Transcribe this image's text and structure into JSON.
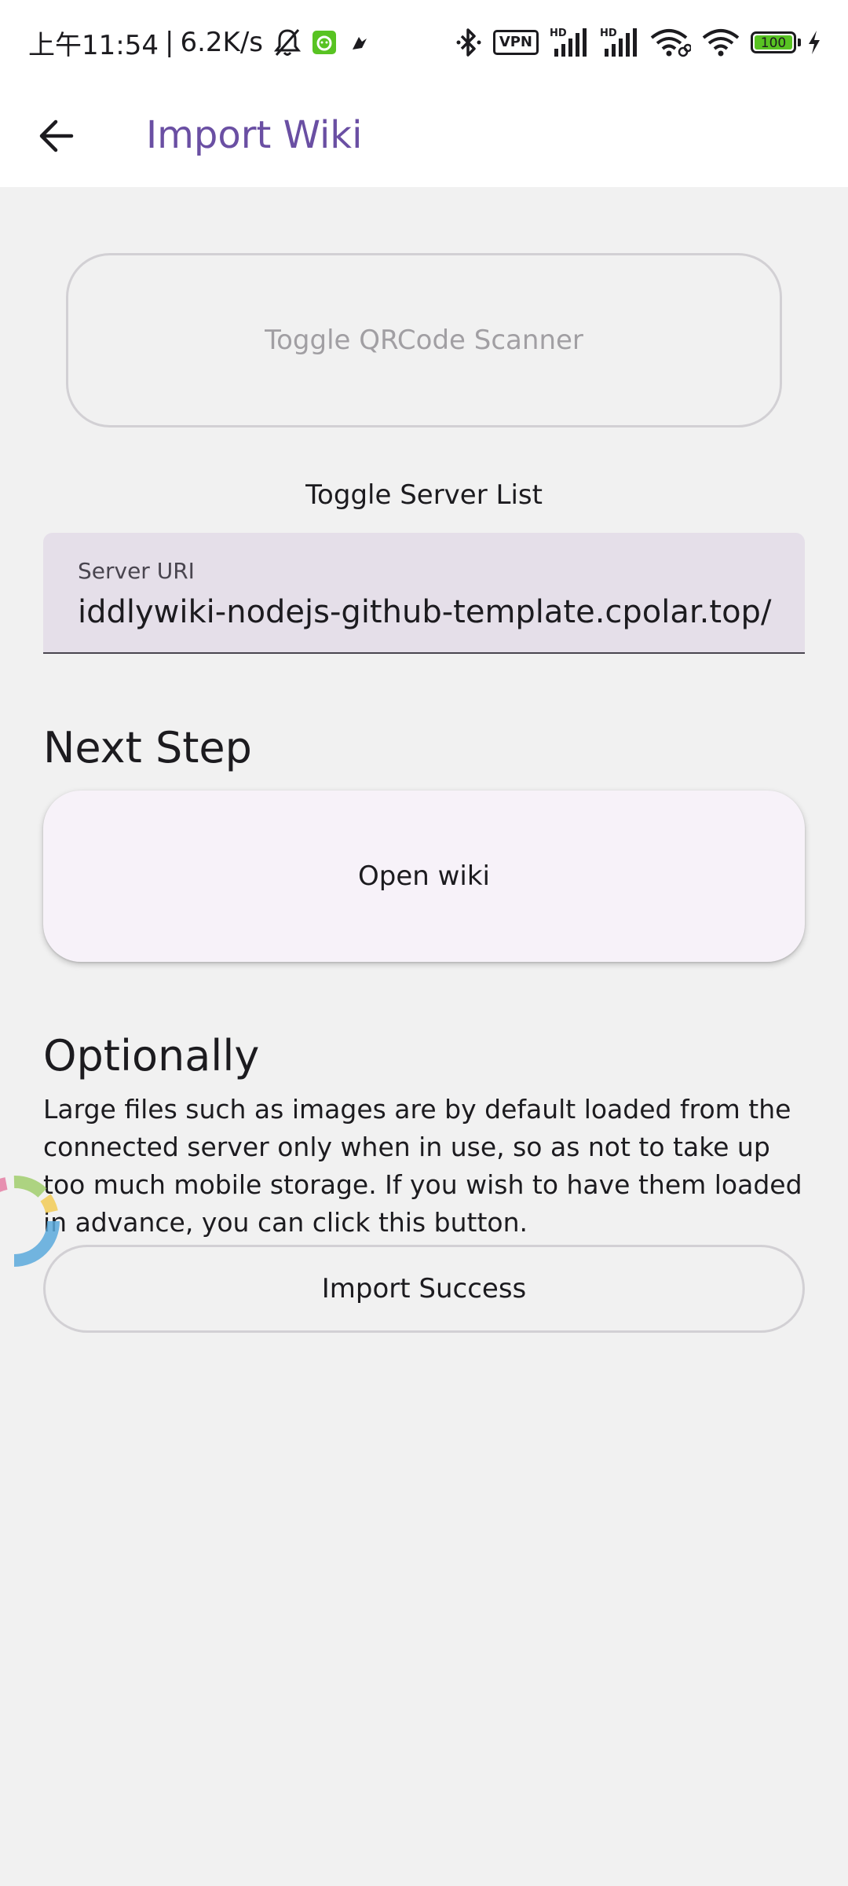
{
  "status_bar": {
    "time": "上午11:54",
    "net_speed": "6.2K/s",
    "vpn_label": "VPN",
    "hd_label": "HD",
    "battery_level": "100",
    "icons": [
      "bell-off-icon",
      "app-notification-icon",
      "bird-icon",
      "bluetooth-icon",
      "vpn-icon",
      "signal-hd-icon",
      "signal-hd-icon",
      "wifi-link-icon",
      "wifi-icon",
      "battery-icon",
      "charging-icon"
    ]
  },
  "app_bar": {
    "back_icon": "arrow-back-icon",
    "title": "Import Wiki"
  },
  "colors": {
    "accent": "#6a4fa3",
    "background": "#f1f1f1",
    "input_fill": "#e5dfe9",
    "primary_button_fill": "#f7f2f9",
    "outline": "#d2d0d4",
    "disabled_text": "#a19fa3",
    "battery_green": "#58c322"
  },
  "main": {
    "qr_scanner_label": "Toggle QRCode Scanner",
    "server_list_label": "Toggle Server List",
    "server_uri": {
      "label": "Server URI",
      "value": "iddlywiki-nodejs-github-template.cpolar.top/"
    },
    "next_step": {
      "heading": "Next Step",
      "open_wiki_label": "Open wiki"
    },
    "optionally": {
      "heading": "Optionally",
      "description": "Large files such as images are by default loaded from the connected server only when in use, so as not to take up too much mobile storage. If you wish to have them loaded in advance, you can click this button.",
      "import_label": "Import Success"
    }
  }
}
